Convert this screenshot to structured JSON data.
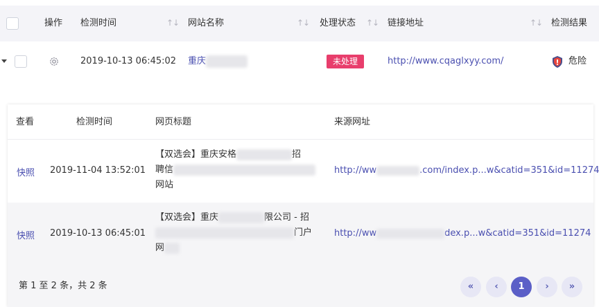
{
  "header": {
    "col_action": "操作",
    "col_time": "检测时间",
    "col_site": "网站名称",
    "col_status": "处理状态",
    "col_url": "链接地址",
    "col_result": "检测结果"
  },
  "row": {
    "time": "2019-10-13 06:45:02",
    "site": "重庆",
    "status": "未处理",
    "url": "http://www.cqaglxyy.com/",
    "result": "危险",
    "status_color": "#e83e6c",
    "icons": {
      "settings": "gear-icon",
      "result": "shield-danger-icon",
      "expand": "caret-down-icon"
    }
  },
  "sub": {
    "header": {
      "col_view": "查看",
      "col_time": "检测时间",
      "col_title": "网页标题",
      "col_source": "来源网址"
    },
    "rows": [
      {
        "view": "快照",
        "time": "2019-11-04 13:52:01",
        "title_l1a": "【双选会】重庆安格",
        "title_l1b": "招",
        "title_l2": "聘信",
        "title_l3": "网站",
        "url_a": "http://ww",
        "url_b": ".com/index.p...w&catid=351&id=11274"
      },
      {
        "view": "快照",
        "time": "2019-10-13 06:45:01",
        "title_l1a": "【双选会】重庆",
        "title_l1b": "限公司 - 招",
        "title_l2b": "门户",
        "title_l3": "网",
        "url_a": "http://ww",
        "url_b": "dex.p...w&catid=351&id=11274"
      }
    ],
    "footer": {
      "info": "第 1 至 2 条，共 2 条",
      "current_page": "1",
      "first": "«",
      "prev": "‹",
      "next": "›",
      "last": "»"
    }
  },
  "colors": {
    "accent": "#5b5fc7",
    "link": "#4a4fb0",
    "header_bg": "#f4f4f8"
  }
}
